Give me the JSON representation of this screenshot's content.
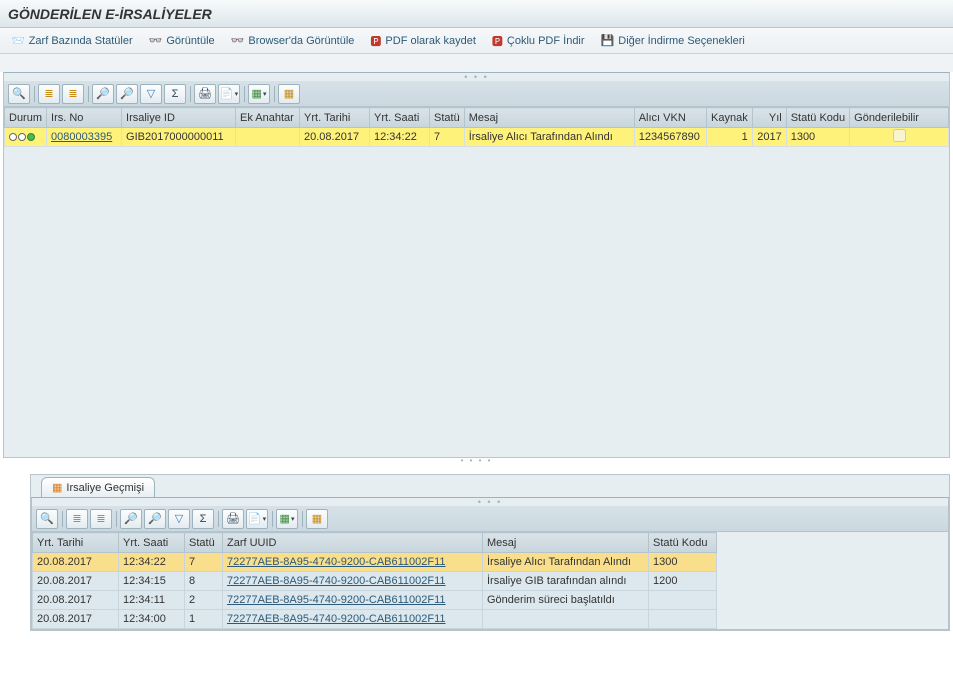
{
  "title": "GÖNDERİLEN E-İRSALİYELER",
  "toolbar": {
    "zarf_statuler": "Zarf Bazında Statüler",
    "goruntule": "Görüntüle",
    "browser_goruntule": "Browser'da Görüntüle",
    "pdf_kaydet": "PDF olarak kaydet",
    "coklu_pdf": "Çoklu PDF İndir",
    "diger_indirme": "Diğer İndirme Seçenekleri"
  },
  "grid1": {
    "headers": {
      "durum": "Durum",
      "irs_no": "Irs. No",
      "irsaliye_id": "Irsaliye ID",
      "ek_anahtar": "Ek Anahtar",
      "yrt_tarihi": "Yrt. Tarihi",
      "yrt_saati": "Yrt. Saati",
      "statu": "Statü",
      "mesaj": "Mesaj",
      "alici_vkn": "Alıcı VKN",
      "kaynak": "Kaynak",
      "yil": "Yıl",
      "statu_kodu": "Statü Kodu",
      "gonderilebilir": "Gönderilebilir"
    },
    "rows": [
      {
        "irs_no": "0080003395",
        "irsaliye_id": "GIB2017000000011",
        "ek_anahtar": "",
        "yrt_tarihi": "20.08.2017",
        "yrt_saati": "12:34:22",
        "statu": "7",
        "mesaj": "İrsaliye Alıcı Tarafından Alındı",
        "alici_vkn": "1234567890",
        "kaynak": "1",
        "yil": "2017",
        "statu_kodu": "1300",
        "gonderilebilir": false
      }
    ]
  },
  "tab_label": "Irsaliye Geçmişi",
  "grid2": {
    "headers": {
      "yrt_tarihi": "Yrt. Tarihi",
      "yrt_saati": "Yrt. Saati",
      "statu": "Statü",
      "zarf_uuid": "Zarf UUID",
      "mesaj": "Mesaj",
      "statu_kodu": "Statü Kodu"
    },
    "rows": [
      {
        "yrt_tarihi": "20.08.2017",
        "yrt_saati": "12:34:22",
        "statu": "7",
        "zarf_uuid": "72277AEB-8A95-4740-9200-CAB611002F11",
        "mesaj": "İrsaliye Alıcı Tarafından Alındı",
        "statu_kodu": "1300"
      },
      {
        "yrt_tarihi": "20.08.2017",
        "yrt_saati": "12:34:15",
        "statu": "8",
        "zarf_uuid": "72277AEB-8A95-4740-9200-CAB611002F11",
        "mesaj": "İrsaliye GIB tarafından alındı",
        "statu_kodu": "1200"
      },
      {
        "yrt_tarihi": "20.08.2017",
        "yrt_saati": "12:34:11",
        "statu": "2",
        "zarf_uuid": "72277AEB-8A95-4740-9200-CAB611002F11",
        "mesaj": "Gönderim süreci başlatıldı",
        "statu_kodu": ""
      },
      {
        "yrt_tarihi": "20.08.2017",
        "yrt_saati": "12:34:00",
        "statu": "1",
        "zarf_uuid": "72277AEB-8A95-4740-9200-CAB611002F11",
        "mesaj": "",
        "statu_kodu": ""
      }
    ]
  }
}
